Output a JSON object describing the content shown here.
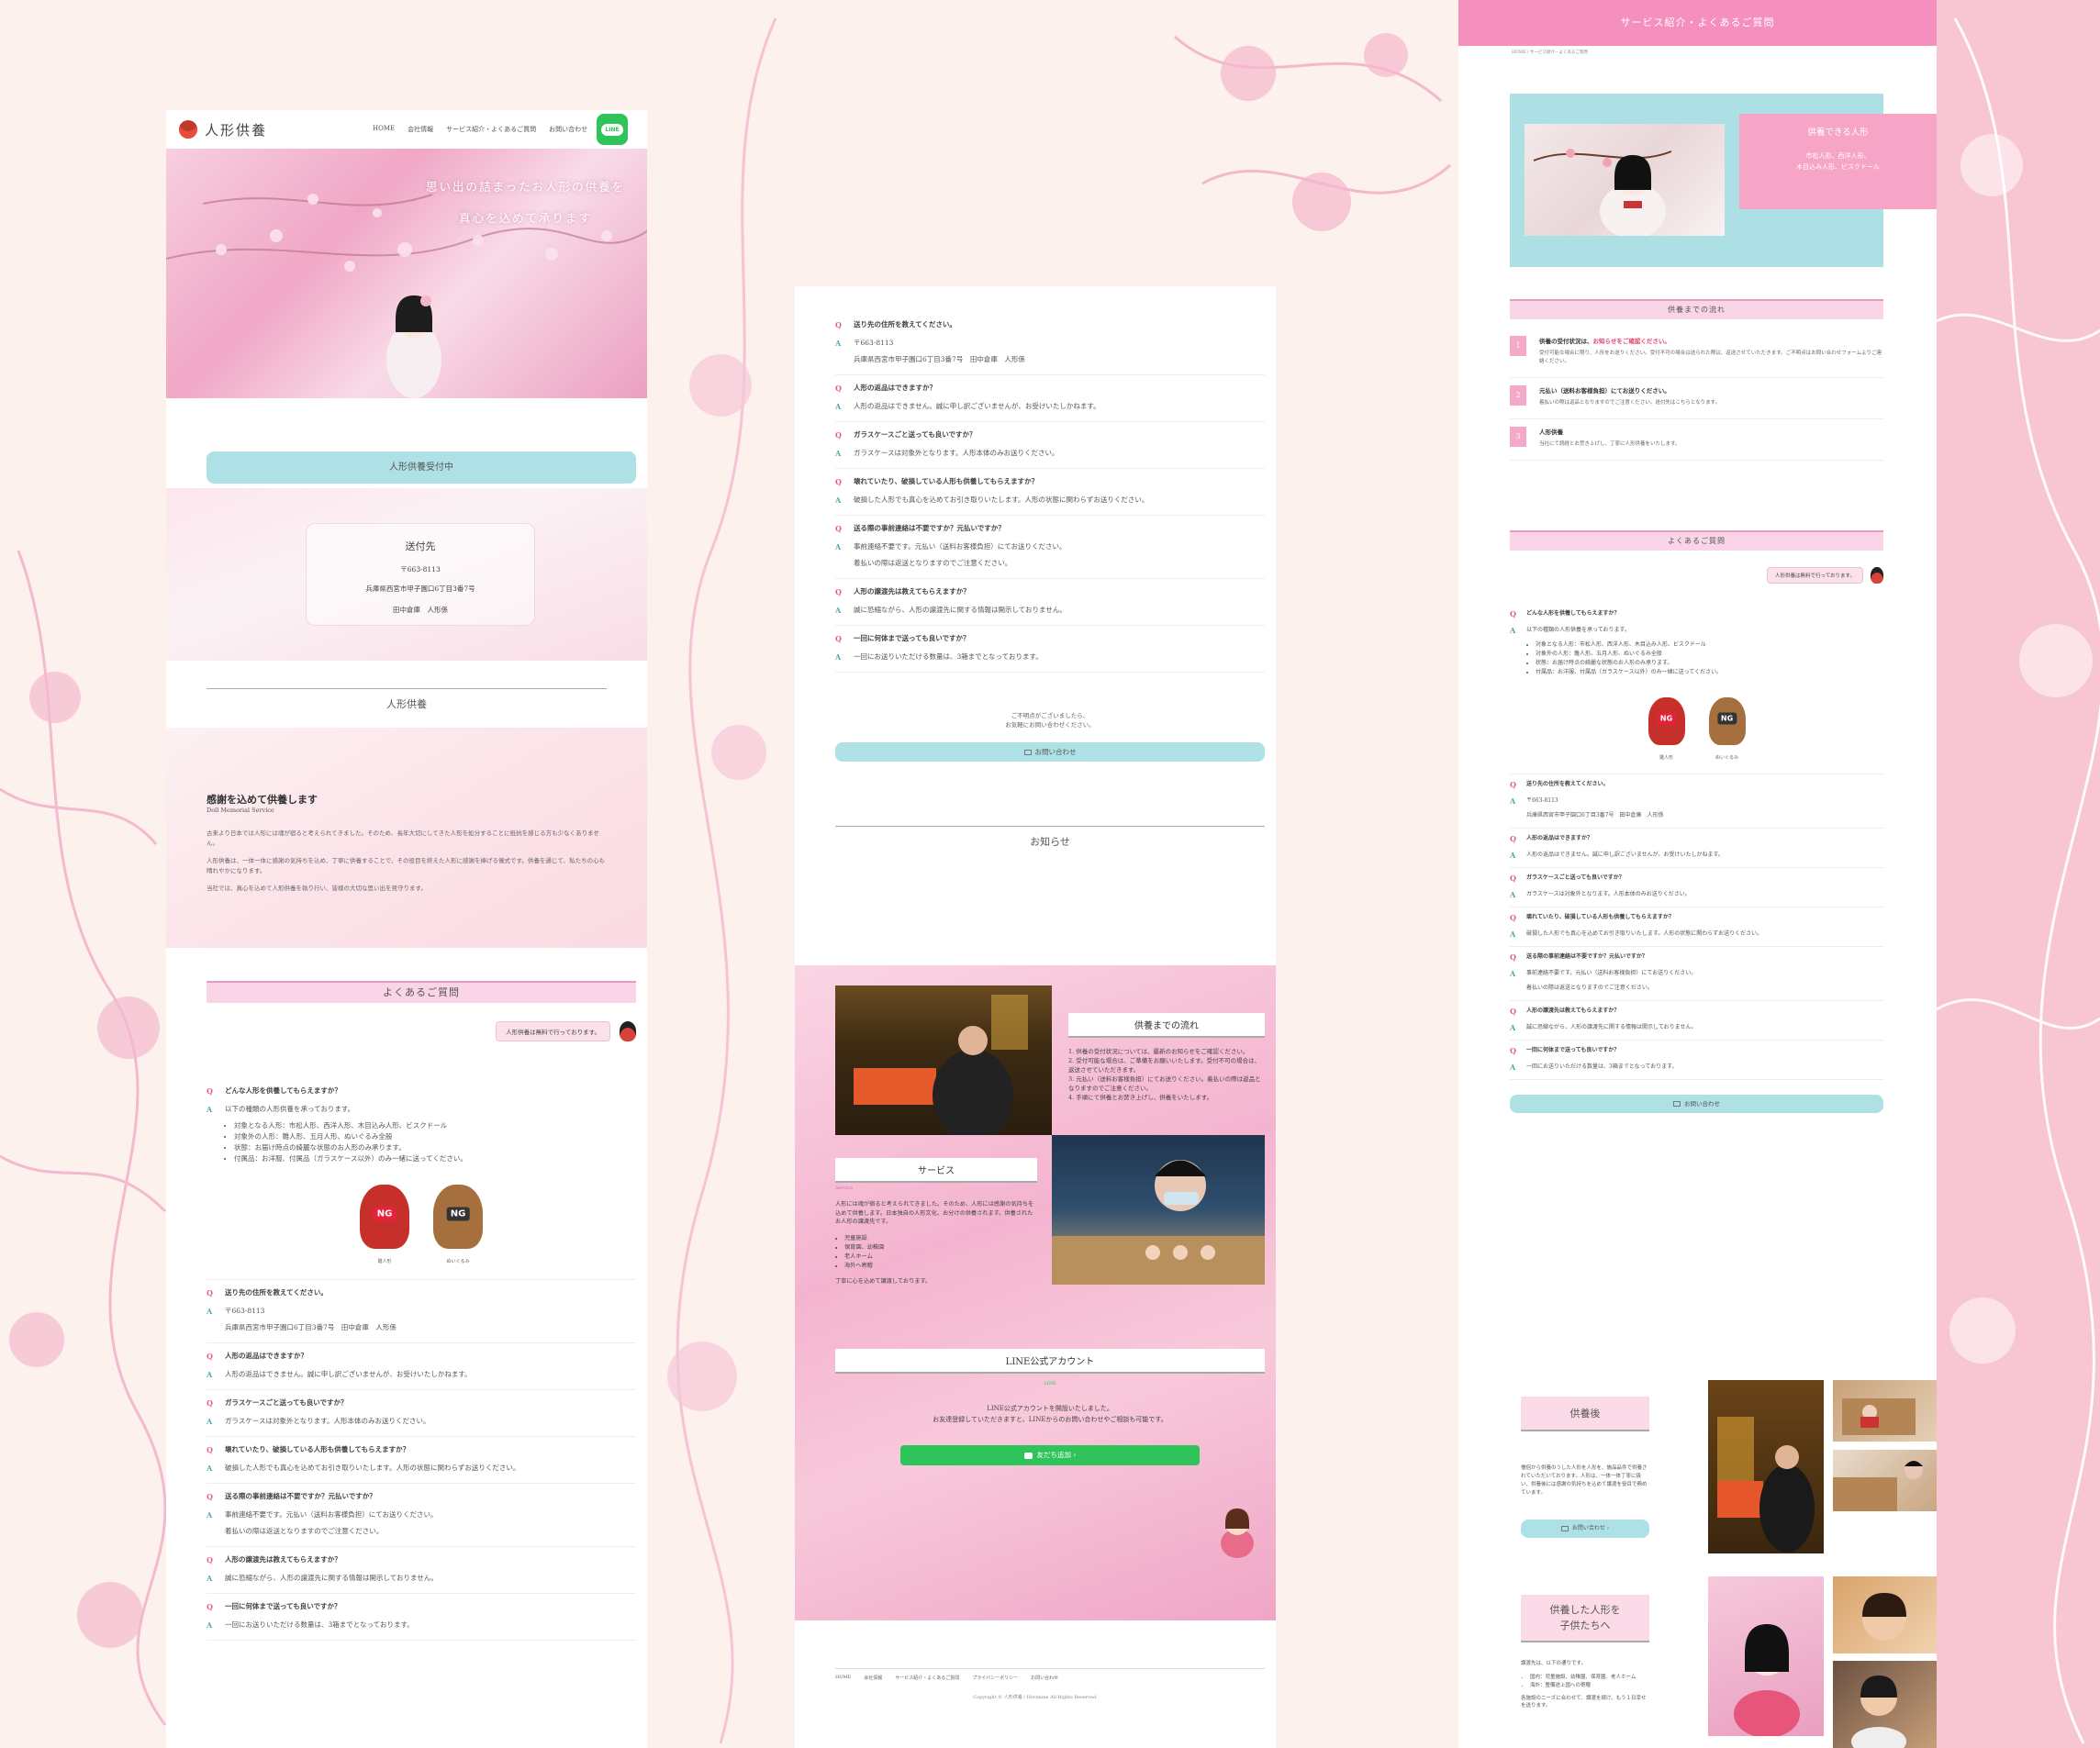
{
  "site": {
    "logo_text": "人形供養",
    "nav": [
      "HOME",
      "会社情報",
      "サービス紹介・よくあるご質問",
      "お問い合わせ"
    ],
    "line_icon": "LINE"
  },
  "hero": {
    "line1": "思い出の詰まったお人形の供養を",
    "line2": "真心を込めて承ります"
  },
  "banner_reception": "人形供養受付中",
  "address": {
    "title": "送付先",
    "zip": "〒663-8113",
    "addr": "兵庫県西宮市甲子園口6丁目3番7号",
    "name": "田中倉庫　人形係"
  },
  "section_kuyou": {
    "title": "人形供養",
    "heading": "感謝を込めて供養します",
    "sub": "Doll Memorial Service",
    "p1": "古来より日本では人形には魂が宿ると考えられてきました。そのため、長年大切にしてきた人形を処分することに抵抗を感じる方も少なくありません。",
    "p2": "人形供養は、一体一体に感謝の気持ちを込め、丁寧に供養することで、その役目を終えた人形に感謝を捧げる儀式です。供養を通じて、私たちの心も晴れやかになります。",
    "p3": "当社では、真心を込めて人形供養を執り行い、皆様の大切な思い出を見守ります。"
  },
  "faq": {
    "title": "よくあるご質問",
    "notice": "人形供養は無料で行っております。",
    "ng_label_1": "雛人形",
    "ng_label_2": "ぬいぐるみ",
    "items": [
      {
        "q": "どんな人形を供養してもらえますか？",
        "a": "以下の種類の人形供養を承っております。",
        "bullets": [
          "対象となる人形：市松人形、西洋人形、木目込み人形、ビスクドール",
          "対象外の人形：雛人形、五月人形、ぬいぐるみ全般",
          "状態：お届け時点の綺麗な状態のお人形のみ承ります。",
          "付属品：お洋服、付属品（ガラスケース以外）のみ一緒に送ってください。"
        ]
      },
      {
        "q": "送り先の住所を教えてください。",
        "a": "〒663-8113",
        "a2": "兵庫県西宮市甲子園口6丁目3番7号　田中倉庫　人形係"
      },
      {
        "q": "人形の返品はできますか？",
        "a": "人形の返品はできません。誠に申し訳ございませんが、お受けいたしかねます。"
      },
      {
        "q": "ガラスケースごと送っても良いですか？",
        "a": "ガラスケースは対象外となります。人形本体のみお送りください。"
      },
      {
        "q": "壊れていたり、破損している人形も供養してもらえますか？",
        "a": "破損した人形でも真心を込めてお引き取りいたします。人形の状態に関わらずお送りください。"
      },
      {
        "q": "送る際の事前連絡は不要ですか？元払いですか？",
        "a": "事前連絡不要です。元払い（送料お客様負担）にてお送りください。",
        "a2": "着払いの際は返送となりますのでご注意ください。"
      },
      {
        "q": "人形の譲渡先は教えてもらえますか？",
        "a": "誠に恐縮ながら、人形の譲渡先に関する情報は開示しておりません。"
      },
      {
        "q": "一回に何体まで送っても良いですか？",
        "a": "一回にお送りいただける数量は、3箱までとなっております。"
      }
    ]
  },
  "contact": {
    "text1": "ご不明点がございましたら、",
    "text2": "お気軽にお問い合わせください。",
    "button": "お問い合わせ"
  },
  "news_title": "お知らせ",
  "flow_box": {
    "title": "供養までの流れ",
    "items": [
      "1. 供養の受付状況については、最新のお知らせをご確認ください。",
      "2. 受付可能な場合は、ご準備をお願いいたします。受付不可の場合は、返送させていただきます。",
      "3. 元払い（送料お客様負担）にてお送りください。着払いの際は返品となりますのでご注意ください。",
      "4. 手順にて供養とお焚き上げし、供養をいたします。"
    ]
  },
  "service_box": {
    "title": "サービス",
    "sub": "Service",
    "text": "人形には魂が宿ると考えられてきました。そのため、人形には感謝の気持ちを込めて供養します。日本独自の人形文化、お分けの供養されます。供養されたお人形の譲渡先です。",
    "bullets": [
      "児童施設",
      "保育園、幼稚園",
      "老人ホーム",
      "海外へ寄贈"
    ],
    "foot": "丁寧に心を込めて譲渡しております。"
  },
  "line_section": {
    "title": "LINE公式アカウント",
    "sub": "LINE",
    "text1": "LINE公式アカウントを開設いたしました。",
    "text2": "お友達登録していただきますと、LINEからのお問い合わせやご相談も可能です。",
    "button": "友だち追加"
  },
  "footer": {
    "links": [
      "HOME",
      "会社情報",
      "サービス紹介・よくあるご質問",
      "プライバシーポリシー",
      "お問い合わせ"
    ],
    "copy": "Copyright © 人形供養 / Hiromine All Rights Reserved."
  },
  "page3": {
    "header": "サービス紹介・よくあるご質問",
    "breadcrumb": "HOME / サービス紹介・よくあるご質問",
    "dolls_title": "供養できる人形",
    "dolls_line1": "市松人形、西洋人形、",
    "dolls_line2": "木目込み人形、ビスクドール",
    "flow_title": "供養までの流れ",
    "steps": [
      {
        "n": "1",
        "title": "供養の受付状況は、",
        "title_em": "お知らせをご確認ください。",
        "body": "受付可能な場合に限り、人形をお送りください。受付不可の場合は送られた際は、返送させていただきます。ご不明点はお問い合わせフォームよりご連絡ください。"
      },
      {
        "n": "2",
        "title": "元払い（送料お客様負担）にてお送りください。",
        "body": "着払いの際は返品となりますのでご注意ください。送付先はこちらとなります。"
      },
      {
        "n": "3",
        "title": "人形供養",
        "body": "当社にて読経とお焚き上げし、丁寧に人形供養をいたします。"
      }
    ],
    "after_title": "供養後",
    "after_text": "僧侶から供養のうした人形を人形を、施品品件で供養されていただいております。人形は、一体一体丁寧に扱い、供養後には感謝の気持ちを込めて譲渡を役目で務めています。",
    "after_button": "お問い合わせ",
    "kids_title_1": "供養した人形を",
    "kids_title_2": "子供たちへ",
    "kids_text": "譲渡先は、以下の通りです。",
    "kids_bullets": [
      "国内：児童施設、幼稚園、保育園、老人ホーム",
      "海外：整備途上国への寄贈"
    ],
    "kids_foot": "各施設のニーズに合わせて、譲渡を続け、もう１日幸せを送ります。"
  },
  "colors": {
    "pink": "#f9d5e7",
    "pink_border": "#e59bc2",
    "teal": "#ade1e6",
    "line_green": "#2ec45a"
  }
}
